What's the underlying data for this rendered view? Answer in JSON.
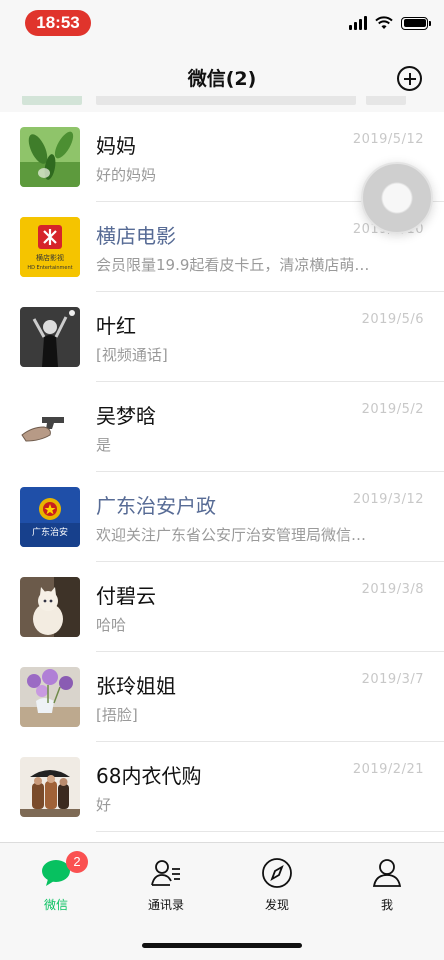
{
  "status_bar": {
    "time": "18:53"
  },
  "nav": {
    "title": "微信(2)"
  },
  "chats": [
    {
      "name": "妈妈",
      "preview": "好的妈妈",
      "date": "2019/5/12",
      "official": false,
      "avatar": "plant-avatar"
    },
    {
      "name": "横店电影",
      "preview": "会员限量19.9起看皮卡丘，清凉横店萌…",
      "date": "2019/5/10",
      "official": true,
      "avatar": "hengdian-logo-avatar"
    },
    {
      "name": "叶红",
      "preview": "[视频通话]",
      "date": "2019/5/6",
      "official": false,
      "avatar": "person-photo-avatar"
    },
    {
      "name": "吴梦晗",
      "preview": "是",
      "date": "2019/5/2",
      "official": false,
      "avatar": "hand-gun-avatar"
    },
    {
      "name": "广东治安户政",
      "preview": "欢迎关注广东省公安厅治安管理局微信…",
      "date": "2019/3/12",
      "official": true,
      "avatar": "police-emblem-avatar"
    },
    {
      "name": "付碧云",
      "preview": "哈哈",
      "date": "2019/3/8",
      "official": false,
      "avatar": "cat-avatar"
    },
    {
      "name": "张玲姐姐",
      "preview": "[捂脸]",
      "date": "2019/3/7",
      "official": false,
      "avatar": "flowers-avatar"
    },
    {
      "name": "68内衣代购",
      "preview": "好",
      "date": "2019/2/21",
      "official": false,
      "avatar": "group-photo-avatar"
    }
  ],
  "avatar_texts": {
    "hengdian_logo": "横店影视",
    "hengdian_sub": "HD Entertainment",
    "police": "广东治安"
  },
  "tabs": [
    {
      "label": "微信",
      "icon": "chat-bubble-icon",
      "active": true,
      "badge": "2"
    },
    {
      "label": "通讯录",
      "icon": "contacts-icon",
      "active": false
    },
    {
      "label": "发现",
      "icon": "compass-icon",
      "active": false
    },
    {
      "label": "我",
      "icon": "person-icon",
      "active": false
    }
  ],
  "colors": {
    "accent": "#07c160",
    "badge": "#fa5151",
    "official_name": "#576b95",
    "time_pill": "#e0342c"
  }
}
